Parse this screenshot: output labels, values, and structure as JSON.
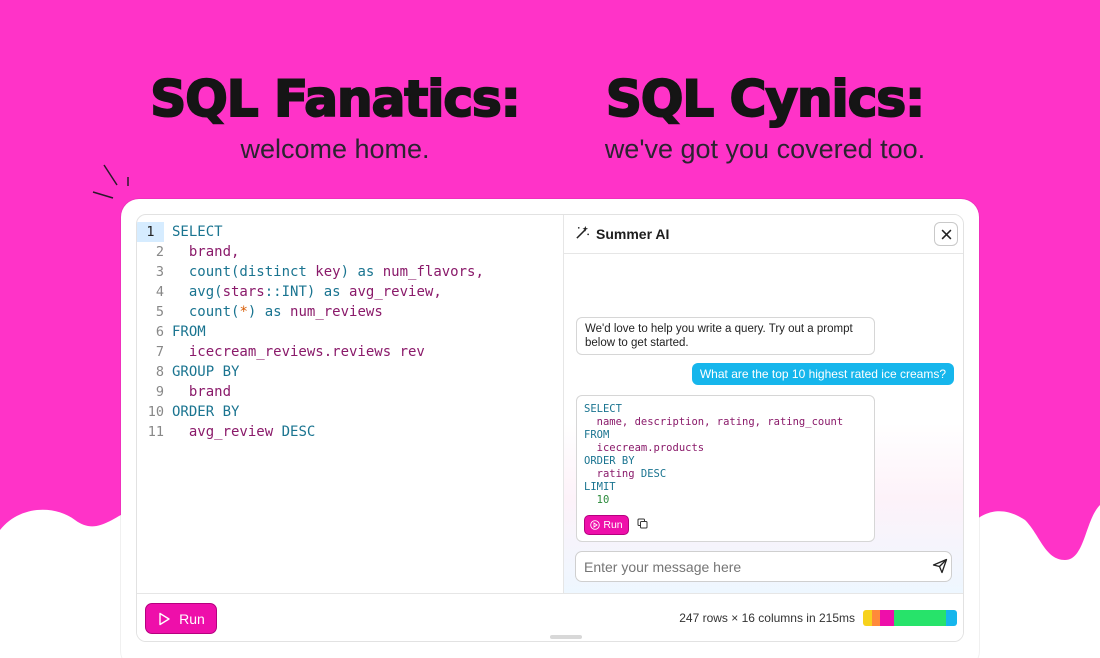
{
  "colors": {
    "background": "#ff33c8",
    "accent": "#ee0faa",
    "user_bubble": "#16b6ec",
    "keyword": "#1a7490",
    "identifier": "#8a1a6a"
  },
  "hero": {
    "left_title": "SQL Fanatics:",
    "left_subtitle": "welcome home.",
    "right_title": "SQL Cynics:",
    "right_subtitle": "we've got you covered too."
  },
  "editor": {
    "line_numbers": [
      "1",
      "2",
      "3",
      "4",
      "5",
      "6",
      "7",
      "8",
      "9",
      "10",
      "11"
    ],
    "active_line": "1"
  },
  "assistant": {
    "title": "Summer AI",
    "wand_icon": "magic-wand-icon",
    "close_icon": "close-icon",
    "greeting": "We'd love to help you write a query. Try out a prompt below to get started.",
    "user_prompt": "What are the top 10 highest rated ice creams?",
    "run_label": "Run",
    "copy_icon": "copy-icon",
    "input_placeholder": "Enter your message here",
    "send_icon": "send-icon"
  },
  "footer": {
    "run_label": "Run",
    "status": "247 rows × 16 columns in 215ms",
    "timing_colors": [
      "#f7d21c",
      "#ff8a3a",
      "#ee0faa",
      "#27e36a",
      "#16b6ec"
    ]
  }
}
